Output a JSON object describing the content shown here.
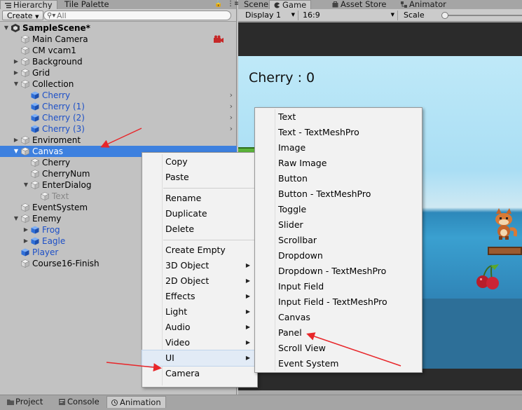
{
  "hierarchy": {
    "tabs": [
      "Hierarchy",
      "Tile Palette"
    ],
    "create_label": "Create",
    "search_placeholder": "All",
    "rows": [
      {
        "label": "SampleScene*",
        "depth": 0,
        "arrow": "down",
        "icon": "unity-scene-icon",
        "bold": true
      },
      {
        "label": "Main Camera",
        "depth": 1,
        "arrow": "",
        "icon": "cube-icon"
      },
      {
        "label": "CM vcam1",
        "depth": 1,
        "arrow": "",
        "icon": "cube-icon"
      },
      {
        "label": "Background",
        "depth": 1,
        "arrow": "right",
        "icon": "cube-icon"
      },
      {
        "label": "Grid",
        "depth": 1,
        "arrow": "right",
        "icon": "cube-icon"
      },
      {
        "label": "Collection",
        "depth": 1,
        "arrow": "down",
        "icon": "cube-icon"
      },
      {
        "label": "Cherry",
        "depth": 2,
        "arrow": "",
        "icon": "prefab-icon",
        "prefab": true,
        "chevron": true
      },
      {
        "label": "Cherry (1)",
        "depth": 2,
        "arrow": "",
        "icon": "prefab-icon",
        "prefab": true,
        "chevron": true
      },
      {
        "label": "Cherry (2)",
        "depth": 2,
        "arrow": "",
        "icon": "prefab-icon",
        "prefab": true,
        "chevron": true
      },
      {
        "label": "Cherry (3)",
        "depth": 2,
        "arrow": "",
        "icon": "prefab-icon",
        "prefab": true,
        "chevron": true
      },
      {
        "label": "Enviroment",
        "depth": 1,
        "arrow": "right",
        "icon": "cube-icon"
      },
      {
        "label": "Canvas",
        "depth": 1,
        "arrow": "down",
        "icon": "cube-icon",
        "selected": true
      },
      {
        "label": "Cherry",
        "depth": 2,
        "arrow": "",
        "icon": "cube-icon"
      },
      {
        "label": "CherryNum",
        "depth": 2,
        "arrow": "",
        "icon": "cube-icon"
      },
      {
        "label": "EnterDialog",
        "depth": 2,
        "arrow": "down",
        "icon": "cube-icon"
      },
      {
        "label": "Text",
        "depth": 3,
        "arrow": "",
        "icon": "cube-icon",
        "dim": true
      },
      {
        "label": "EventSystem",
        "depth": 1,
        "arrow": "",
        "icon": "cube-icon"
      },
      {
        "label": "Enemy",
        "depth": 1,
        "arrow": "down",
        "icon": "cube-icon"
      },
      {
        "label": "Frog",
        "depth": 2,
        "arrow": "right",
        "icon": "prefab-icon",
        "prefab": true
      },
      {
        "label": "Eagle",
        "depth": 2,
        "arrow": "right",
        "icon": "prefab-icon",
        "prefab": true
      },
      {
        "label": "Player",
        "depth": 1,
        "arrow": "",
        "icon": "prefab-icon",
        "prefab": true
      },
      {
        "label": "Course16-Finish",
        "depth": 1,
        "arrow": "",
        "icon": "cube-icon"
      }
    ]
  },
  "game": {
    "tabs": [
      "Scene",
      "Game",
      "Asset Store",
      "Animator"
    ],
    "display": "Display 1",
    "aspect": "16:9",
    "scale_label": "Scale",
    "score_text": "Cherry : 0"
  },
  "context_menu": {
    "items": [
      "Copy",
      "Paste",
      "---",
      "Rename",
      "Duplicate",
      "Delete",
      "---",
      "Create Empty",
      "3D Object",
      "2D Object",
      "Effects",
      "Light",
      "Audio",
      "Video",
      "UI",
      "Camera"
    ],
    "submenu_items": [
      "3D Object",
      "2D Object",
      "Effects",
      "Light",
      "Audio",
      "Video",
      "UI"
    ],
    "highlighted": "UI"
  },
  "ui_submenu": {
    "items": [
      "Text",
      "Text - TextMeshPro",
      "Image",
      "Raw Image",
      "Button",
      "Button - TextMeshPro",
      "Toggle",
      "Slider",
      "Scrollbar",
      "Dropdown",
      "Dropdown - TextMeshPro",
      "Input Field",
      "Input Field - TextMeshPro",
      "Canvas",
      "Panel",
      "Scroll View",
      "Event System"
    ]
  },
  "bottom_tabs": [
    "Project",
    "Console",
    "Animation"
  ],
  "colors": {
    "selection": "#3d80df",
    "prefab_text": "#1c4fc7",
    "annotation_arrow": "#e8262a"
  }
}
